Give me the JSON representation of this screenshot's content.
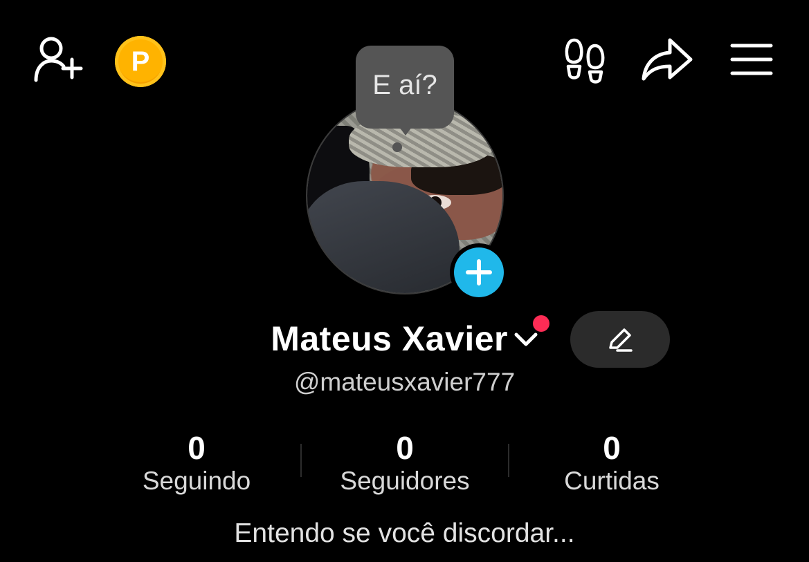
{
  "header": {
    "icons": [
      "add-friend-icon",
      "coin-icon",
      "footprints-icon",
      "share-icon",
      "menu-icon"
    ],
    "coin_label": "P",
    "coin_color": "#ffb300"
  },
  "profile": {
    "bubble_text": "E aí?",
    "display_name": "Mateus Xavier",
    "handle": "@mateusxavier777",
    "notification_color": "#fe2c55",
    "add_avatar_color": "#20b8ea"
  },
  "stats": [
    {
      "value": "0",
      "label": "Seguindo"
    },
    {
      "value": "0",
      "label": "Seguidores"
    },
    {
      "value": "0",
      "label": "Curtidas"
    }
  ],
  "bio": "Entendo se você discordar..."
}
